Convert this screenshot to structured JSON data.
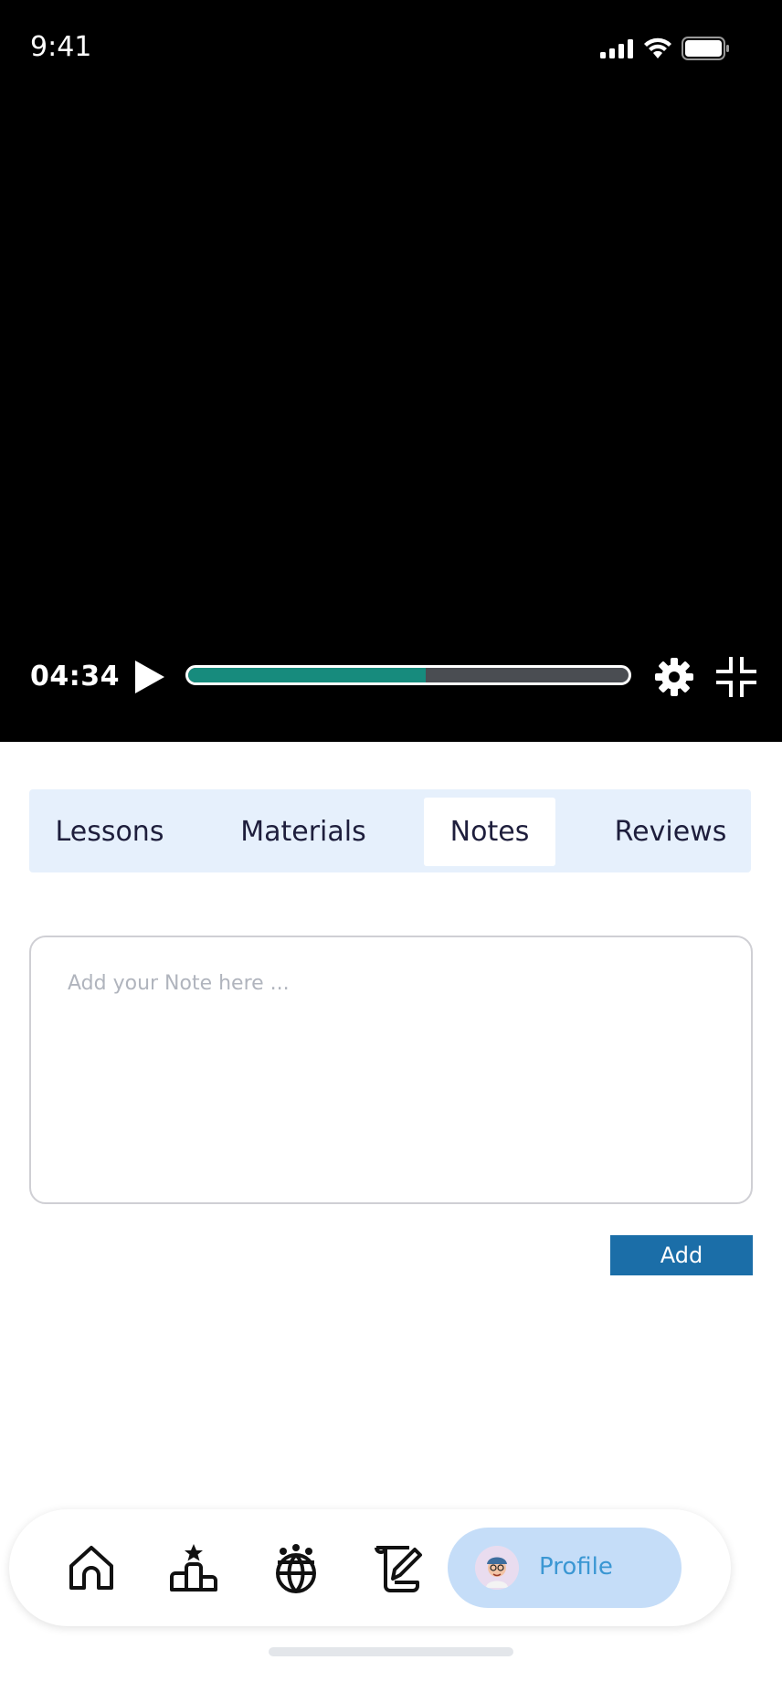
{
  "status_bar": {
    "time": "9:41"
  },
  "player": {
    "current_time": "04:34",
    "progress_fraction": 0.54,
    "colors": {
      "fill": "#178b7d",
      "track": "#4a4d52"
    },
    "icons": [
      "play-icon",
      "gear-icon",
      "collapse-icon"
    ]
  },
  "tabs": [
    {
      "label": "Lessons",
      "active": false
    },
    {
      "label": "Materials",
      "active": false
    },
    {
      "label": "Notes",
      "active": true
    },
    {
      "label": "Reviews",
      "active": false
    }
  ],
  "note": {
    "placeholder": "Add your Note here ..."
  },
  "add_button": {
    "label": "Add"
  },
  "bottom_nav": {
    "items": [
      "home-icon",
      "leaderboard-icon",
      "community-icon",
      "certificate-icon"
    ],
    "profile_label": "Profile"
  },
  "colors": {
    "accent": "#1b6ea8",
    "tab_bg": "#e6f0fc",
    "profile_pill": "#c5ddf8",
    "profile_text": "#3b97d3"
  }
}
